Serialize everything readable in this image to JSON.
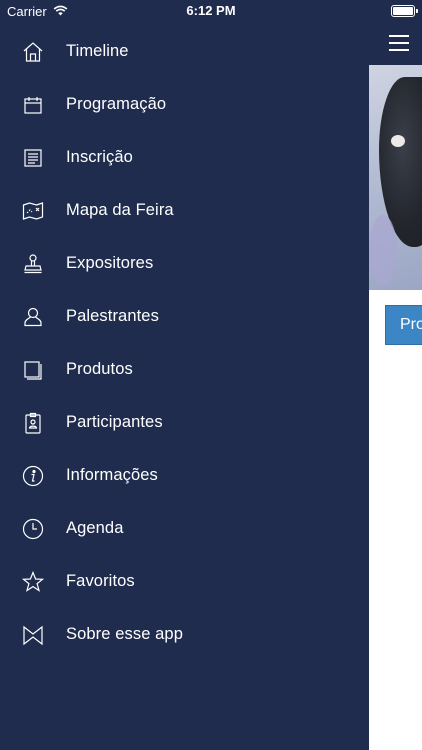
{
  "status_bar": {
    "carrier": "Carrier",
    "time": "6:12 PM"
  },
  "menu": [
    {
      "id": "timeline",
      "label": "Timeline",
      "icon": "home-icon"
    },
    {
      "id": "programacao",
      "label": "Programação",
      "icon": "calendar-icon"
    },
    {
      "id": "inscricao",
      "label": "Inscrição",
      "icon": "document-icon"
    },
    {
      "id": "mapa",
      "label": "Mapa da Feira",
      "icon": "map-icon"
    },
    {
      "id": "expositores",
      "label": "Expositores",
      "icon": "stamp-icon"
    },
    {
      "id": "palestrantes",
      "label": "Palestrantes",
      "icon": "person-icon"
    },
    {
      "id": "produtos",
      "label": "Produtos",
      "icon": "pages-icon"
    },
    {
      "id": "participantes",
      "label": "Participantes",
      "icon": "badge-icon"
    },
    {
      "id": "informacoes",
      "label": "Informações",
      "icon": "info-icon"
    },
    {
      "id": "agenda",
      "label": "Agenda",
      "icon": "clock-icon"
    },
    {
      "id": "favoritos",
      "label": "Favoritos",
      "icon": "star-icon"
    },
    {
      "id": "sobre",
      "label": "Sobre esse app",
      "icon": "envelope-icon"
    }
  ],
  "peek": {
    "button_label": "Pro"
  },
  "colors": {
    "drawer_bg": "#1f2c4e",
    "accent_button": "#3d86c6"
  }
}
